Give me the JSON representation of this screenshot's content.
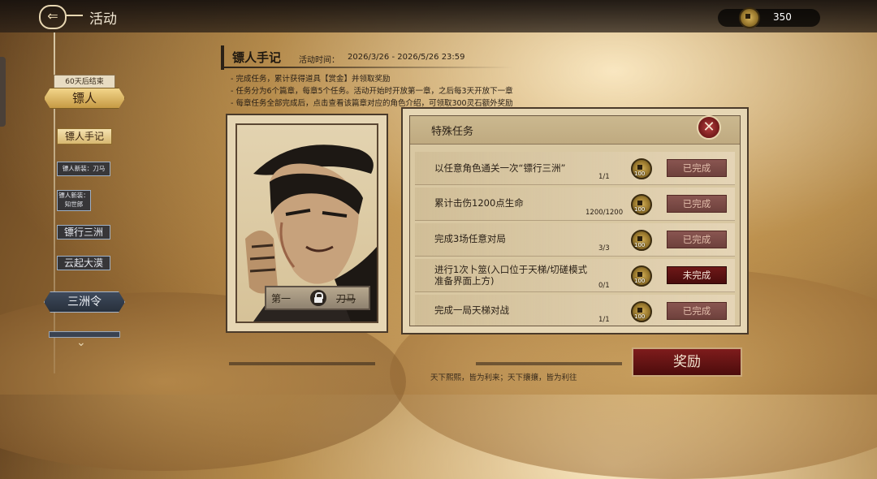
{
  "topbar": {
    "title": "活动",
    "back_icon": "back-arrow-icon",
    "currency_value": "350",
    "currency_icon": "coin-icon"
  },
  "sidebar": {
    "timer_badge": "60天后结束",
    "category": "镖人",
    "items": [
      {
        "label": "镖人手记",
        "active": true
      },
      {
        "label": "镖人新装：刀马",
        "active": false
      },
      {
        "label": "镖人新装：知世郎",
        "active": false
      },
      {
        "label": "镖行三洲",
        "active": false
      },
      {
        "label": "云起大漠",
        "active": false
      }
    ],
    "category2": "三洲令"
  },
  "header": {
    "title": "镖人手记",
    "time_label": "活动时间：",
    "time_range": "2026/3/26 - 2026/5/26 23:59",
    "rules": [
      "- 完成任务，累计获得道具【赏金】并领取奖励",
      "- 任务分为6个篇章，每章5个任务。活动开始时开放第一章，之后每3天开放下一章",
      "- 每章任务全部完成后，点击查看该篇章对应的角色介绍，可领取300灵石额外奖励"
    ]
  },
  "chapter": {
    "left": "第一",
    "right": "刀马",
    "lock_icon": "lock-icon"
  },
  "tasks": {
    "title": "特殊任务",
    "close_icon": "close-icon",
    "rows": [
      {
        "text": "以任意角色通关一次“镖行三洲”",
        "progress": "1/1",
        "reward": "100",
        "status": "已完成",
        "state": "done"
      },
      {
        "text": "累计击伤1200点生命",
        "progress": "1200/1200",
        "reward": "100",
        "status": "已完成",
        "state": "done"
      },
      {
        "text": "完成3场任意对局",
        "progress": "3/3",
        "reward": "100",
        "status": "已完成",
        "state": "done"
      },
      {
        "text": "进行1次卜筮(入口位于天梯/切磋模式准备界面上方)",
        "progress": "0/1",
        "reward": "100",
        "status": "未完成",
        "state": "todo"
      },
      {
        "text": "完成一局天梯对战",
        "progress": "1/1",
        "reward": "100",
        "status": "已完成",
        "state": "done"
      }
    ]
  },
  "reward_button": "奖励",
  "footer_quote": "天下熙熙，皆为利来；天下攘攘，皆为利往",
  "colors": {
    "accent_red": "#6e1c1c",
    "parchment": "#e6d6b4",
    "ink": "#2b2117",
    "gold": "#c69a44"
  }
}
